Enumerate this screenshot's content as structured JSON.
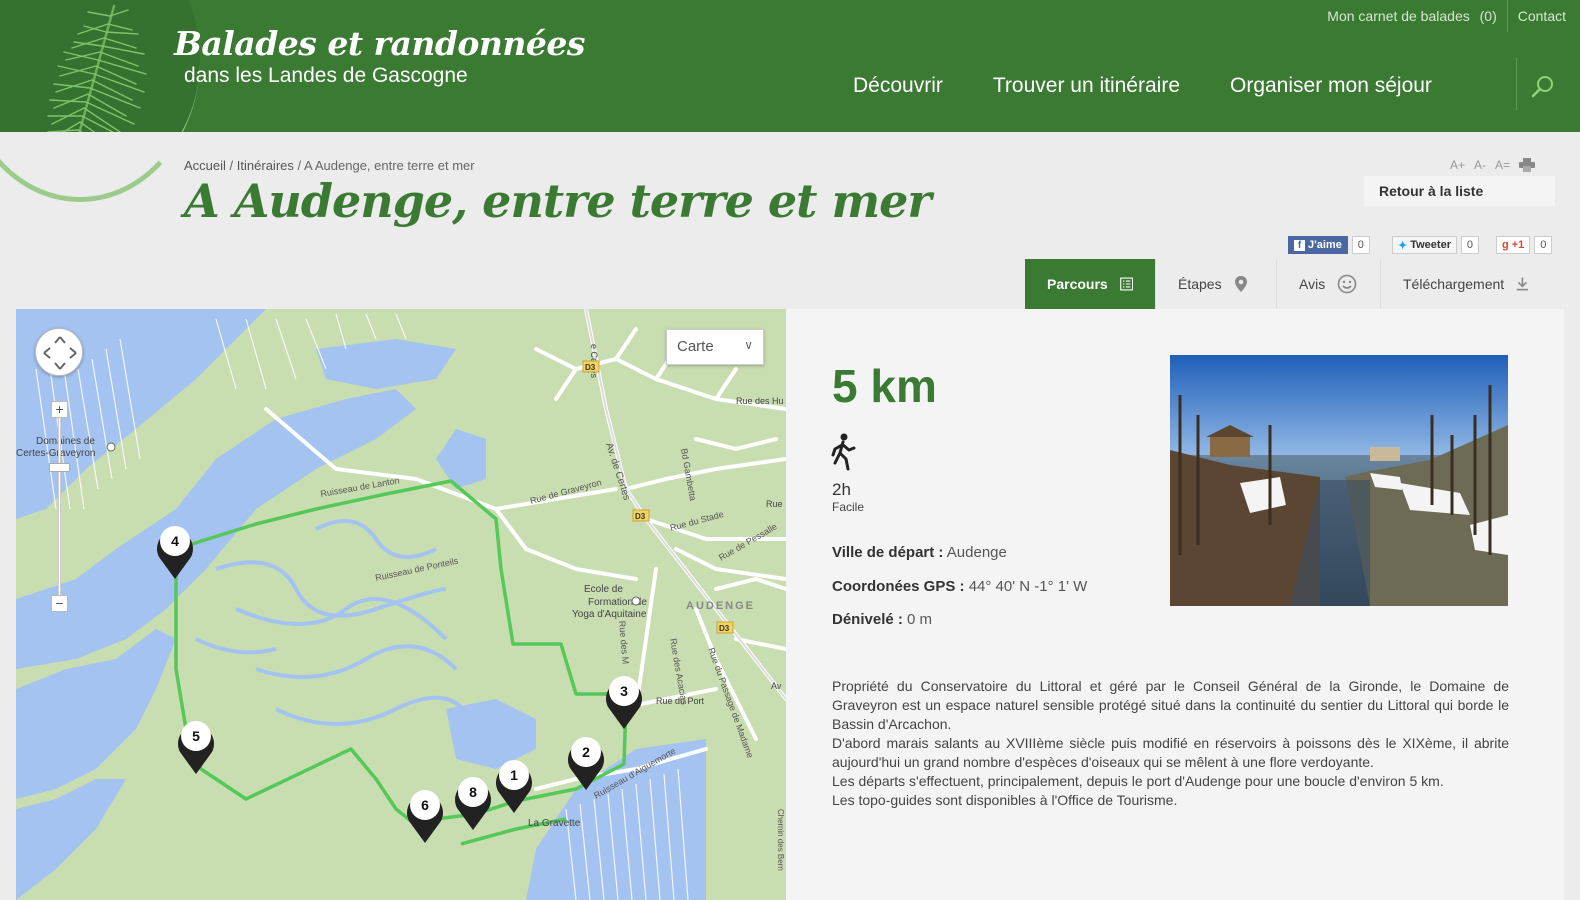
{
  "header": {
    "site_title": "Balades et randonnées",
    "site_subtitle": "dans les Landes de Gascogne",
    "top_links": {
      "carnet_label": "Mon carnet de balades",
      "carnet_count": "(0)",
      "contact_label": "Contact"
    },
    "nav": [
      {
        "label": "Découvrir"
      },
      {
        "label": "Trouver un itinéraire"
      },
      {
        "label": "Organiser mon séjour"
      }
    ],
    "search_icon": "search-icon"
  },
  "breadcrumb": {
    "items": [
      "Accueil",
      "Itinéraires",
      "A Audenge, entre terre et mer"
    ],
    "separator": "/"
  },
  "page_title": "A Audenge, entre terre et mer",
  "font_tools": {
    "increase": "A+",
    "decrease": "A-",
    "reset": "A=",
    "print_icon": "print-icon"
  },
  "back_to_list": "Retour à la liste",
  "social": {
    "facebook": {
      "label": "J'aime",
      "count": "0"
    },
    "twitter": {
      "label": "Tweeter",
      "count": "0"
    },
    "gplus": {
      "label": "+1",
      "count": "0"
    }
  },
  "tabs": [
    {
      "label": "Parcours",
      "icon": "list-icon",
      "active": true
    },
    {
      "label": "Étapes",
      "icon": "pin-icon",
      "active": false
    },
    {
      "label": "Avis",
      "icon": "smiley-icon",
      "active": false
    },
    {
      "label": "Téléchargement",
      "icon": "download-icon",
      "active": false
    }
  ],
  "map": {
    "type_selector": "Carte",
    "labels": {
      "domaines": "Domaines de",
      "certes_graveyron": "Certes-Graveyron",
      "ruisseau_lanton": "Ruisseau de Lanton",
      "ruisseau_ponteils": "Ruisseau de Ponteils",
      "rue_graveyron": "Rue de Graveyron",
      "av_certes": "Av. de Certes",
      "bd_gambetta": "Bd Gambetta",
      "rue_stade": "Rue du Stade",
      "rue_pessalle": "Rue de Pessalle",
      "ecole_1": "Ecole de",
      "ecole_2": "Formation de",
      "ecole_3": "Yoga d'Aquitaine",
      "audenge": "AUDENGE",
      "rue_port": "Rue du Port",
      "la_gravette": "La Gravette",
      "ruisseau_aiguemorte": "Ruisseau d'Aiguemorte",
      "rue_acacias": "Rue des Acacias",
      "rue_passage_madame": "Rue du Passage de Madame",
      "d3": "D3",
      "rue_des_hu": "Rue des Hu",
      "certes_top": "e Certes",
      "rue_m": "Rue des M",
      "chemin_bern": "Chemin des Bern",
      "rue_side": "Rue",
      "av_side": "Av"
    },
    "markers": [
      "1",
      "2",
      "3",
      "4",
      "5",
      "6",
      "8"
    ]
  },
  "info": {
    "distance": "5 km",
    "walker_icon": "hiker-icon",
    "duration": "2h",
    "difficulty": "Facile",
    "ville_label": "Ville de départ :",
    "ville_value": "Audenge",
    "gps_label": "Coordonées GPS :",
    "gps_value": "44° 40' N -1° 1' W",
    "denivele_label": "Dénivelé :",
    "denivele_value": "0 m",
    "description": [
      "Propriété du Conservatoire du Littoral et géré par le Conseil Général de la Gironde, le Domaine de Graveyron est un espace naturel sensible protégé situé dans la continuité du sentier du Littoral qui borde le Bassin d'Arcachon.",
      "D'abord marais salants au XVIIIème siècle puis modifié en réservoirs à poissons dès le XIXème, il abrite aujourd'hui un grand nombre d'espèces d'oiseaux qui se mêlent à une flore verdoyante.",
      "Les départs s'effectuent, principalement, depuis le port d'Audenge pour une boucle d'environ 5 km.",
      "Les topo-guides sont disponibles à l'Office de Tourisme."
    ]
  },
  "colors": {
    "brand_green": "#3a7a33",
    "route_green": "#55c85a",
    "water": "#a4c3f0",
    "land": "#c8ddb0"
  }
}
